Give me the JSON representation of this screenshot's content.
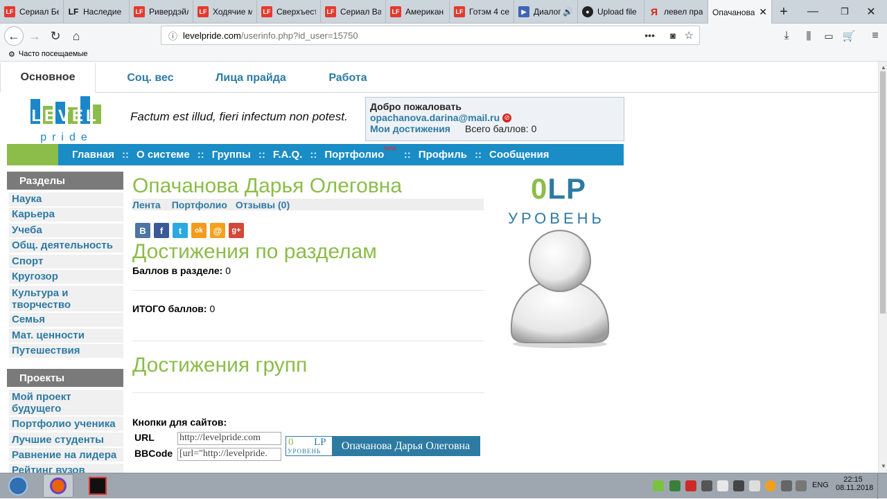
{
  "browser": {
    "tabs": [
      {
        "icon": "lf-icon",
        "title": "Сериал Бе"
      },
      {
        "icon": "lf-icon",
        "title": "Наследие"
      },
      {
        "icon": "lf-icon",
        "title": "Ривердэйл"
      },
      {
        "icon": "lf-icon",
        "title": "Ходячие м"
      },
      {
        "icon": "lf-icon",
        "title": "Сверхъест"
      },
      {
        "icon": "lf-icon",
        "title": "Сериал Ва"
      },
      {
        "icon": "lf-icon",
        "title": "Американ"
      },
      {
        "icon": "lf-icon",
        "title": "Готэм 4 се"
      },
      {
        "icon": "play-icon",
        "title": "Диалог"
      },
      {
        "icon": "github-icon",
        "title": "Upload file"
      },
      {
        "icon": "yandex-icon",
        "title": "левел пра"
      },
      {
        "icon": "",
        "title": "Опачанова"
      }
    ],
    "url_host": "levelpride.com",
    "url_path": "/userinfo.php?id_user=15750",
    "bookmarks_label": "Часто посещаемые"
  },
  "site": {
    "top_tabs": [
      "Основное",
      "Соц. вес",
      "Лица прайда",
      "Работа"
    ],
    "logo_text": "LEVEL",
    "logo_sub": "pride",
    "motto": "Factum est illud, fieri infectum non potest.",
    "welcome": {
      "title": "Добро пожаловать",
      "email": "opachanova.darina@mail.ru",
      "achievements_link": "Мои достижения",
      "total_points": "Всего баллов: 0"
    },
    "menu": {
      "items": [
        "Главная",
        "О системе",
        "Группы",
        "F.A.Q.",
        "Портфолио",
        "Профиль",
        "Сообщения"
      ],
      "separator": "::",
      "beta": "beta"
    }
  },
  "sidebar": {
    "sections_title": "Разделы",
    "sections": [
      "Наука",
      "Карьера",
      "Учеба",
      "Общ. деятельность",
      "Спорт",
      "Кругозор",
      "Культура и творчество",
      "Семья",
      "Мат. ценности",
      "Путешествия"
    ],
    "projects_title": "Проекты",
    "projects": [
      "Мой проект будущего",
      "Портфолио ученика",
      "Лучшие студенты",
      "Равнение на лидера",
      "Рейтинг вузов"
    ]
  },
  "profile": {
    "name": "Опачанова Дарья Олеговна",
    "subtabs": [
      "Лента",
      "Портфолио",
      "Отзывы (0)"
    ],
    "social": [
      "В",
      "f",
      "t",
      "ok",
      "@",
      "g+"
    ],
    "achievements_title": "Достижения по разделам",
    "points_in_section_label": "Баллов в разделе:",
    "points_in_section_value": "0",
    "total_label": "ИТОГО баллов:",
    "total_value": "0",
    "group_title": "Достижения групп",
    "lp_value": "0",
    "lp_unit": "LP",
    "level_label": "УРОВЕНЬ"
  },
  "buttons": {
    "title": "Кнопки для сайтов:",
    "url_label": "URL",
    "url_value": "http://levelpride.com",
    "bbcode_label": "BBCode",
    "bbcode_value": "[url=\"http://levelpride.",
    "badge_lp": "0",
    "badge_unit": "LP",
    "badge_level": "УРОВЕНЬ",
    "badge_name": "Опачанова Дарья Олеговна"
  },
  "taskbar": {
    "lang": "ENG",
    "time": "22:15",
    "date": "08.11.2018"
  }
}
